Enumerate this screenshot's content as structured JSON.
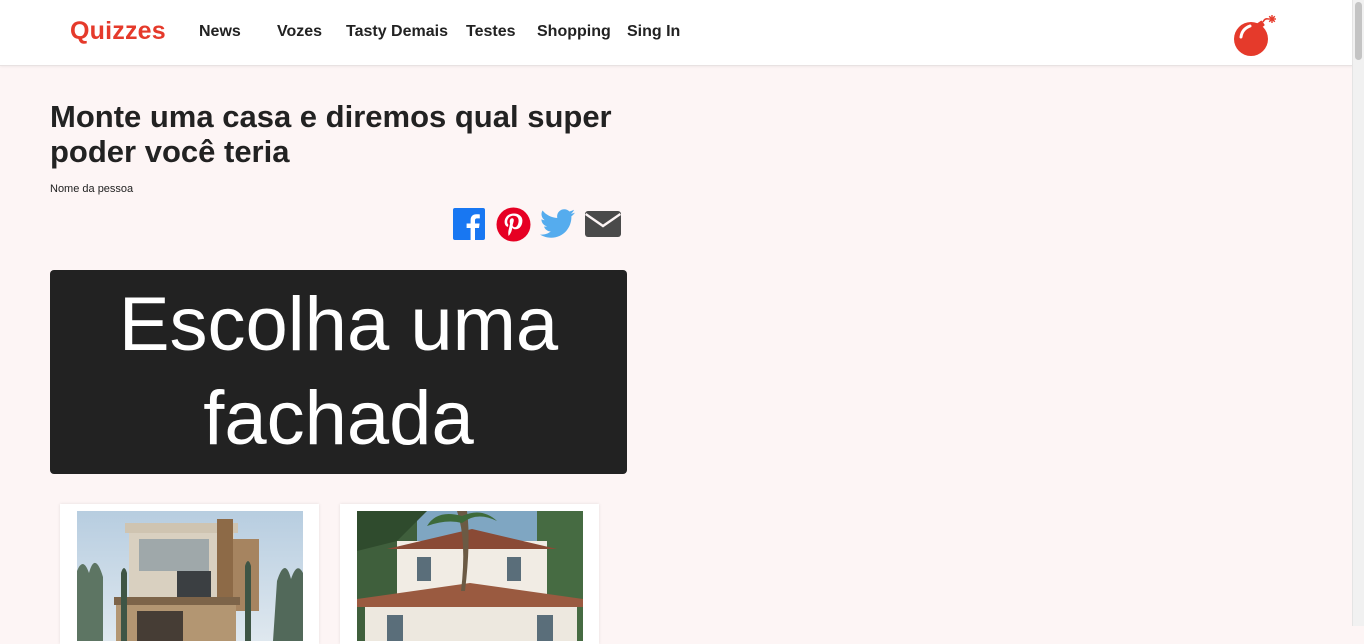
{
  "header": {
    "logo": "Quizzes",
    "nav": [
      {
        "label": "News"
      },
      {
        "label": "Vozes"
      },
      {
        "label": "Tasty Demais"
      },
      {
        "label": "Testes"
      },
      {
        "label": "Shopping"
      },
      {
        "label": "Sing In"
      }
    ],
    "icon": "bomb-icon"
  },
  "article": {
    "title": "Monte uma casa e diremos qual super poder você teria",
    "author": "Nome da pessoa",
    "share_icons": [
      "facebook-icon",
      "pinterest-icon",
      "twitter-icon",
      "email-icon"
    ]
  },
  "question": {
    "text": "Escolha uma fachada",
    "options": [
      {
        "image": "modern-house-photo"
      },
      {
        "image": "tropical-villa-photo"
      }
    ]
  },
  "colors": {
    "brand": "#e53a2b",
    "background": "#fdf5f5",
    "banner": "#222222",
    "facebook": "#1877f2",
    "pinterest": "#e60023",
    "twitter": "#55acee",
    "email": "#4a4a4a"
  }
}
